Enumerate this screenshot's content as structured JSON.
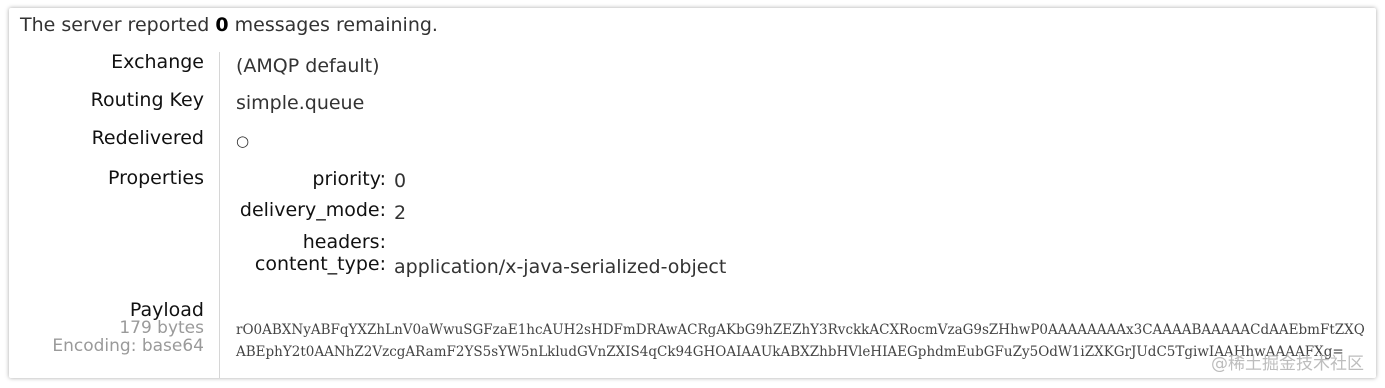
{
  "status": {
    "prefix": "The server reported",
    "count": "0",
    "suffix": "messages remaining."
  },
  "fields": {
    "exchange": {
      "label": "Exchange",
      "value": "(AMQP default)"
    },
    "routing_key": {
      "label": "Routing Key",
      "value": "simple.queue"
    },
    "redelivered": {
      "label": "Redelivered",
      "value": "○"
    },
    "properties": {
      "label": "Properties",
      "items": [
        {
          "key": "priority:",
          "value": "0"
        },
        {
          "key": "delivery_mode:",
          "value": "2"
        },
        {
          "key": "headers:",
          "value": ""
        },
        {
          "key": "content_type:",
          "value": "application/x-java-serialized-object"
        }
      ]
    },
    "payload": {
      "label": "Payload",
      "size": "179 bytes",
      "encoding": "Encoding: base64",
      "value": "rO0ABXNyABFqYXZhLnV0aWwuSGFzaE1hcAUH2sHDFmDRAwACRgAKbG9hZEZhY3RvckkACXRocmVzaG9sZHhwP0AAAAAAAAx3CAAAABAAAAACdAAEbmFtZXQABEphY2t0AANhZ2VzcgARamF2YS5sYW5nLkludGVnZXIS4qCk94GHOAIAAUkABXZhbHVleHIAEGphdmEubGFuZy5OdW1iZXKGrJUdC5TgiwIAAHhwAAAAFXg="
    }
  },
  "watermark": "@稀土掘金技术社区"
}
